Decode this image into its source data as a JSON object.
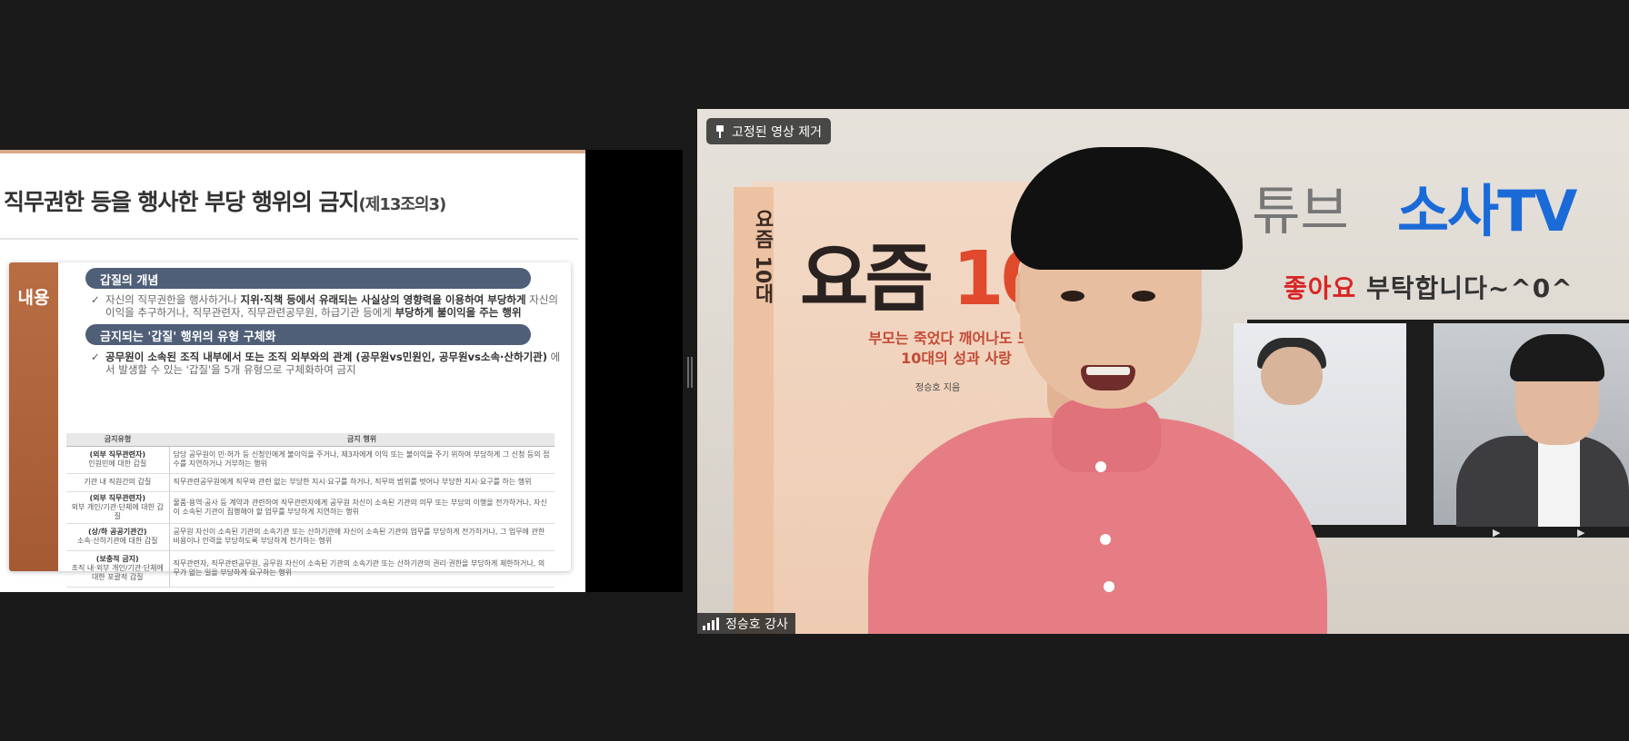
{
  "slide": {
    "title": "직무권한 등을 행사한 부당 행위의 금지",
    "title_suffix": "(제13조의3)",
    "side_label": "내용",
    "section1": {
      "heading": "갑질의 개념",
      "text_a": "자신의 직무권한을 행사하거나 ",
      "text_b": "지위·직책 등에서 유래되는 사실상의 영향력을 이용하여 부당하게",
      "text_c": " 자신의 이익을 추구하거나, 직무관련자, 직무관련공무원, 하급기관 등에게 ",
      "text_d": "부당하게 불이익을 주는 행위"
    },
    "section2": {
      "heading": "금지되는 '갑질' 행위의 유형 구체화",
      "text_a": "공무원이 소속된 조직 내부에서 또는 조직 외부와의 관계 (공무원vs민원인, 공무원vs소속·산하기관)",
      "text_b": " 에서 발생할 수 있는 '갑질'을 5개 유형으로 구체화하여 금지"
    },
    "table": {
      "headers": [
        "금지유형",
        "금지 행위"
      ],
      "rows": [
        {
          "type_bold": "(외부 직무관련자)",
          "type_sub": "인원민에 대한 갑질",
          "desc": "담당 공무원이 민·허가 등 신청인에게 불이익을 주거나, 제3자에게 이익 또는 불이익을 주기 위하여 부당하게 그 신청 등의 접수를 지연하거나 거부하는 행위"
        },
        {
          "type_bold": "",
          "type_sub": "기관 내 직원간의 갑질",
          "desc": "직무관련공무원에게 직무와 관련 없는 부당한 지시·요구를 하거나, 직무의 범위를 벗어나 부당한 지시·요구를 하는 행위"
        },
        {
          "type_bold": "(외부 직무관련자)",
          "type_sub": "외부 개인/기관·단체에 대한 갑질",
          "desc": "물품·용역·공사 등 계약과 관련하여 직무관련자에게 공무원 자신이 소속된 기관의 의무 또는 부담의 이행을 전가하거나, 자신이 소속된 기관이 집행해야 할 업무를 부당하게 지연하는 행위"
        },
        {
          "type_bold": "(상/하 공공기관간)",
          "type_sub": "소속·산하기관에 대한 갑질",
          "desc": "공무원 자신이 소속된 기관의 소속기관 또는 산하기관에 자신이 소속된 기관의 업무를 부당하게 전가하거나, 그 업무에 관한 비용이나 인력을 부당하도록 부당하게 전가하는 행위"
        },
        {
          "type_bold": "(보충적 금지)",
          "type_sub": "조직 내·외부 개인/기관·단체에 대한 포괄적 갑질",
          "desc": "직무관련자, 직무관련공무원, 공무원 자신이 소속된 기관의 소속기관 또는 산하기관의 권리·권한을 부당하게 제한하거나, 의무가 없는 일을 부당하게 요구하는 행위"
        }
      ]
    }
  },
  "video": {
    "pin_label": "고정된 영상 제거",
    "participant_name": "정승호 강사",
    "banner": {
      "youtube": "튜브",
      "channel": "소사TV",
      "like_red": "좋아요",
      "like_rest": " 부탁합니다~^0^",
      "channel_color": "#1a6ad8"
    },
    "book": {
      "title_a": "요즘 ",
      "title_b": "10대",
      "spine": "요즘 10대",
      "subtitle_1": "부모는 죽었다 깨어나도 모를",
      "subtitle_2": "10대의 성과 사랑",
      "author": "정승호 지음"
    }
  }
}
